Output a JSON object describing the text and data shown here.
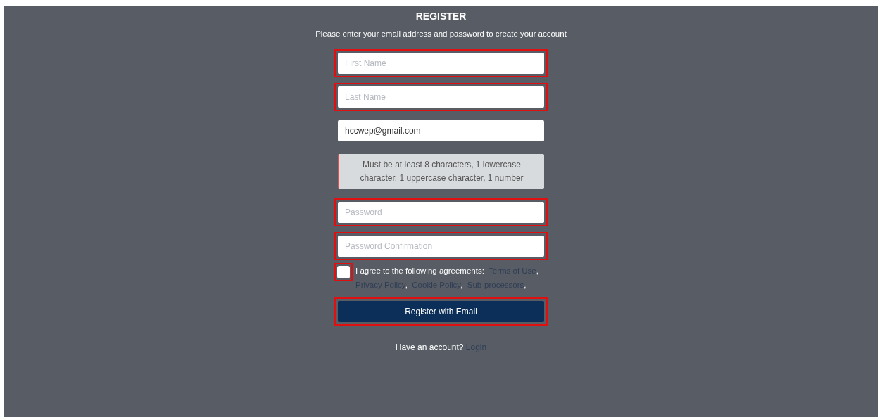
{
  "title": "REGISTER",
  "subtitle": "Please enter your email address and password to create your account",
  "fields": [
    {
      "kind": "input",
      "placeholder": "First Name",
      "highlighted": true
    },
    {
      "kind": "input",
      "placeholder": "Last Name",
      "highlighted": true
    },
    {
      "kind": "input",
      "value": "hccwep@gmail.com",
      "highlighted": false
    },
    {
      "kind": "hint",
      "text": "Must be at least 8 characters, 1 lowercase character, 1 uppercase character, 1 number",
      "highlighted": false
    },
    {
      "kind": "input",
      "placeholder": "Password",
      "highlighted": true
    },
    {
      "kind": "input",
      "placeholder": "Password Confirmation",
      "highlighted": true
    }
  ],
  "agreement": {
    "checked": false,
    "highlighted": true,
    "text": "I agree to the following agreements:",
    "links": [
      "Terms of Use",
      "Privacy Policy",
      "Cookie Policy",
      "Sub-processors"
    ],
    "separator": ","
  },
  "submit": {
    "label": "Register with Email",
    "highlighted": true
  },
  "footer": {
    "text": "Have an account?",
    "link": "Login"
  }
}
